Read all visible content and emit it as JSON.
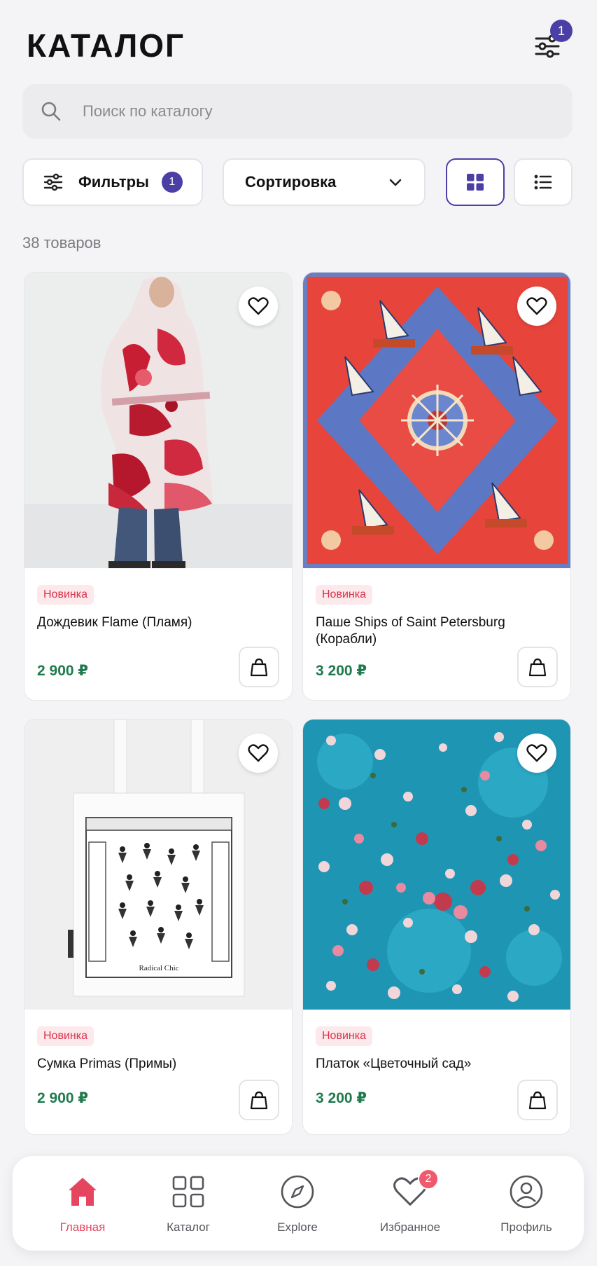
{
  "header": {
    "title": "КАТАЛОГ",
    "filter_badge": "1"
  },
  "search": {
    "placeholder": "Поиск по каталогу"
  },
  "controls": {
    "filters_label": "Фильтры",
    "filters_badge": "1",
    "sort_label": "Сортировка",
    "view_mode": "grid"
  },
  "count_label": "38 товаров",
  "products": [
    {
      "badge": "Новинка",
      "name": "Дождевик Flame (Пламя)",
      "price": "2 900 ₽"
    },
    {
      "badge": "Новинка",
      "name": "Паше Ships of Saint Petersburg (Корабли)",
      "price": "3 200 ₽"
    },
    {
      "badge": "Новинка",
      "name": "Сумка Primas (Примы)",
      "price": "2 900 ₽",
      "image_text": "Radical Chic"
    },
    {
      "badge": "Новинка",
      "name": "Платок «Цветочный сад»",
      "price": "3 200 ₽"
    }
  ],
  "nav": {
    "items": [
      {
        "label": "Главная",
        "icon": "home-icon",
        "active": true
      },
      {
        "label": "Каталог",
        "icon": "grid-icon"
      },
      {
        "label": "Explore",
        "icon": "compass-icon"
      },
      {
        "label": "Избранное",
        "icon": "heart-icon",
        "badge": "2"
      },
      {
        "label": "Профиль",
        "icon": "user-icon"
      }
    ]
  },
  "colors": {
    "accent": "#4b3fa6",
    "price": "#1f7a4d",
    "new_badge": "#d8324a",
    "active_nav": "#e64560"
  }
}
